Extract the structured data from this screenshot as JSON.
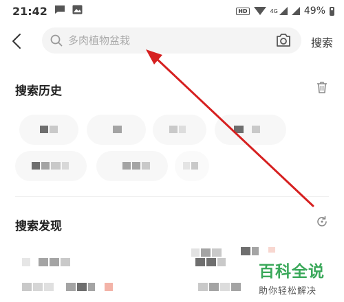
{
  "status_bar": {
    "time": "21:42",
    "battery_percent": "49%",
    "network": "4G",
    "hd": "HD"
  },
  "search": {
    "placeholder": "多肉植物盆栽",
    "submit_label": "搜索"
  },
  "history": {
    "title": "搜索历史"
  },
  "discover": {
    "title": "搜索发现"
  },
  "watermark": {
    "main": "百科全说",
    "sub": "助你轻松解决"
  },
  "colors": {
    "annotation_arrow": "#d62020",
    "watermark_green": "#3aa85a",
    "search_bg": "#f4f4f4"
  },
  "icons": [
    "chat-icon",
    "image-icon",
    "hd-icon",
    "wifi-icon",
    "cellular-icon",
    "battery-icon",
    "back-icon",
    "search-icon",
    "camera-scan-icon",
    "trash-icon",
    "refresh-icon"
  ]
}
